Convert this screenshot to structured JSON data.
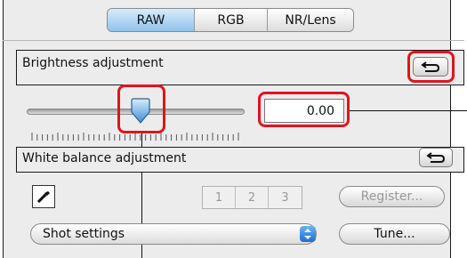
{
  "tabs": [
    {
      "label": "RAW",
      "active": true
    },
    {
      "label": "RGB",
      "active": false
    },
    {
      "label": "NR/Lens",
      "active": false
    }
  ],
  "brightness": {
    "title": "Brightness adjustment",
    "value": "0.00",
    "slider_level": 0.5,
    "undo_icon": "undo-arrow-icon"
  },
  "white_balance": {
    "title": "White balance adjustment",
    "undo_icon": "undo-arrow-icon",
    "eyedropper_icon": "eyedropper-icon",
    "presets": [
      "1",
      "2",
      "3"
    ],
    "register_label": "Register...",
    "setting_value": "Shot settings",
    "tune_label": "Tune..."
  },
  "colors": {
    "callout": "#e0141e",
    "active_tab": "#8fc3ea",
    "select_arrow": "#1f6ecf"
  }
}
